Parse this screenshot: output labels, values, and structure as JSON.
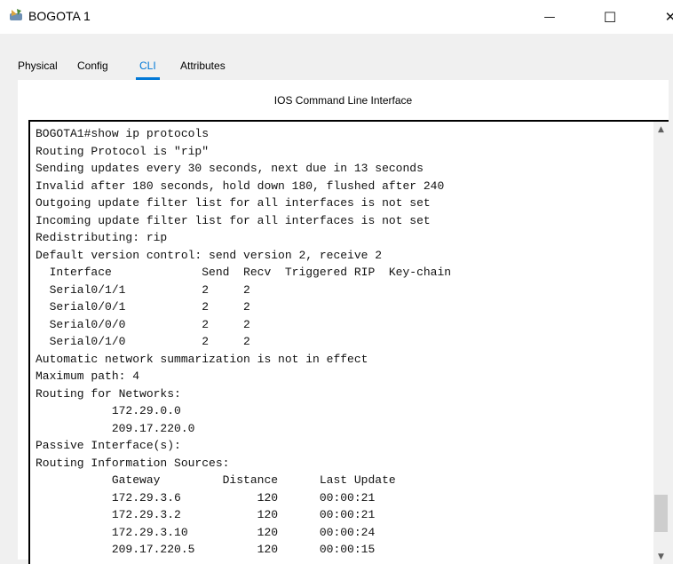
{
  "window": {
    "title": "BOGOTA 1",
    "icon": "router-icon",
    "controls": {
      "minimize": "—",
      "maximize": "☐",
      "close": "✕"
    }
  },
  "tabs": [
    {
      "label": "Physical",
      "active": false
    },
    {
      "label": "Config",
      "active": false
    },
    {
      "label": "CLI",
      "active": true
    },
    {
      "label": "Attributes",
      "active": false
    }
  ],
  "cli": {
    "heading": "IOS Command Line Interface",
    "output": "BOGOTA1#show ip protocols\nRouting Protocol is \"rip\"\nSending updates every 30 seconds, next due in 13 seconds\nInvalid after 180 seconds, hold down 180, flushed after 240\nOutgoing update filter list for all interfaces is not set\nIncoming update filter list for all interfaces is not set\nRedistributing: rip\nDefault version control: send version 2, receive 2\n  Interface             Send  Recv  Triggered RIP  Key-chain\n  Serial0/1/1           2     2\n  Serial0/0/1           2     2\n  Serial0/0/0           2     2\n  Serial0/1/0           2     2\nAutomatic network summarization is not in effect\nMaximum path: 4\nRouting for Networks:\n           172.29.0.0\n           209.17.220.0\nPassive Interface(s):\nRouting Information Sources:\n           Gateway         Distance      Last Update\n           172.29.3.6           120      00:00:21\n           172.29.3.2           120      00:00:21\n           172.29.3.10          120      00:00:24\n           209.17.220.5         120      00:00:15"
  },
  "colors": {
    "accent": "#0078d7",
    "panel_bg": "#f0f0f0"
  }
}
